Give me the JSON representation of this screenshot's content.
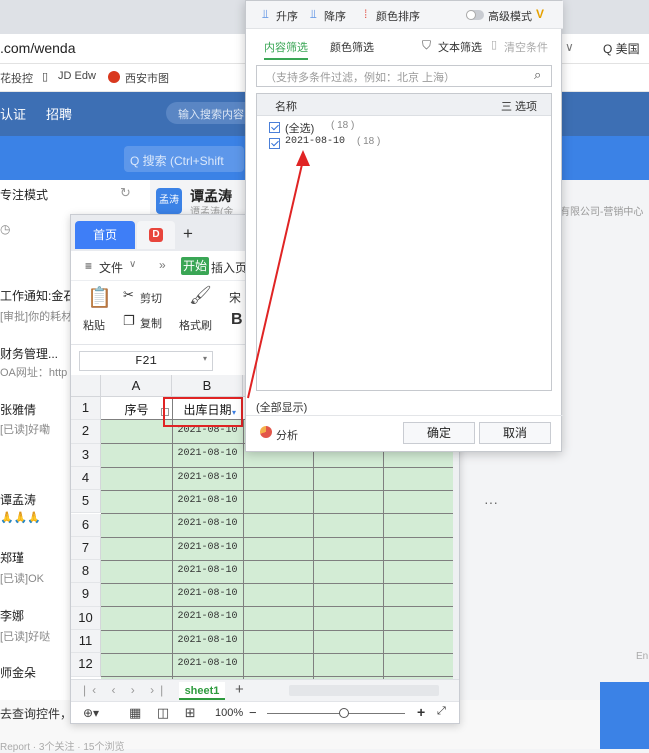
{
  "browser": {
    "url": ".com/wenda",
    "search_engine": "Q 美国",
    "bookmarks": [
      "花投控",
      "JD Edw",
      "西安市图"
    ],
    "nav": [
      "认证",
      "招聘"
    ],
    "nav_search_placeholder": "输入搜索内容"
  },
  "chat": {
    "search_placeholder": "Q 搜索 (Ctrl+Shift",
    "focus_mode": "专注模式",
    "header_name": "谭孟涛",
    "header_avatar": "孟涛",
    "header_sub": "谭孟涛(金",
    "company_fragment": "有限公司-营销中心",
    "ellipsis": "···",
    "items": [
      {
        "name": "工作通知:金石",
        "sub": "[审批]你的耗材"
      },
      {
        "name": "财务管理...",
        "sub": "OA网址：http"
      },
      {
        "name": "张雅倩",
        "sub": "[已读]好嘞"
      },
      {
        "name": "谭孟涛",
        "sub": "🙏🙏🙏"
      },
      {
        "name": "郑瑾",
        "sub": "[已读]OK"
      },
      {
        "name": "李娜",
        "sub": "[已读]好哒"
      },
      {
        "name": "师金朵",
        "sub": ""
      }
    ],
    "bottom_text": "去查询控件，",
    "bottom_meta": "Report  · 3个关注  · 15个浏览",
    "en_label": "En"
  },
  "spreadsheet": {
    "tab_home": "首页",
    "doc_icon": "D",
    "menu": {
      "file": "文件",
      "start": "开始",
      "insert": "插入",
      "more": "页"
    },
    "ribbon": {
      "paste": "粘贴",
      "cut": "剪切",
      "copy": "复制",
      "format_painter": "格式刷",
      "font_fragment": "宋",
      "bold": "B"
    },
    "name_box": "F21",
    "columns": [
      "A",
      "B"
    ],
    "header_row": {
      "a": "序号",
      "b": "出库日期"
    },
    "rows": [
      "2021-08-10",
      "2021-08-10",
      "2021-08-10",
      "2021-08-10",
      "2021-08-10",
      "2021-08-10",
      "2021-08-10",
      "2021-08-10",
      "2021-08-10",
      "2021-08-10",
      "2021-08-10"
    ],
    "row_numbers": [
      "1",
      "2",
      "3",
      "4",
      "5",
      "6",
      "7",
      "8",
      "9",
      "10",
      "11",
      "12"
    ],
    "sheet_tab": "sheet1",
    "zoom": "100%"
  },
  "filter": {
    "sort_asc": "升序",
    "sort_desc": "降序",
    "color_sort": "颜色排序",
    "advanced": "高级模式",
    "tab_content": "内容筛选",
    "tab_color": "颜色筛选",
    "text_filter": "文本筛选",
    "clear": "清空条件",
    "search_placeholder": "（支持多条件过滤，例如：北京  上海）",
    "list_header": "名称",
    "options_label": "三 选项",
    "items": [
      {
        "label": "(全选)",
        "count": "( 18 )"
      },
      {
        "label": "2021-08-10",
        "count": "( 18 )"
      }
    ],
    "show_all": "(全部显示)",
    "analyze": "分析",
    "ok": "确定",
    "cancel": "取消"
  }
}
